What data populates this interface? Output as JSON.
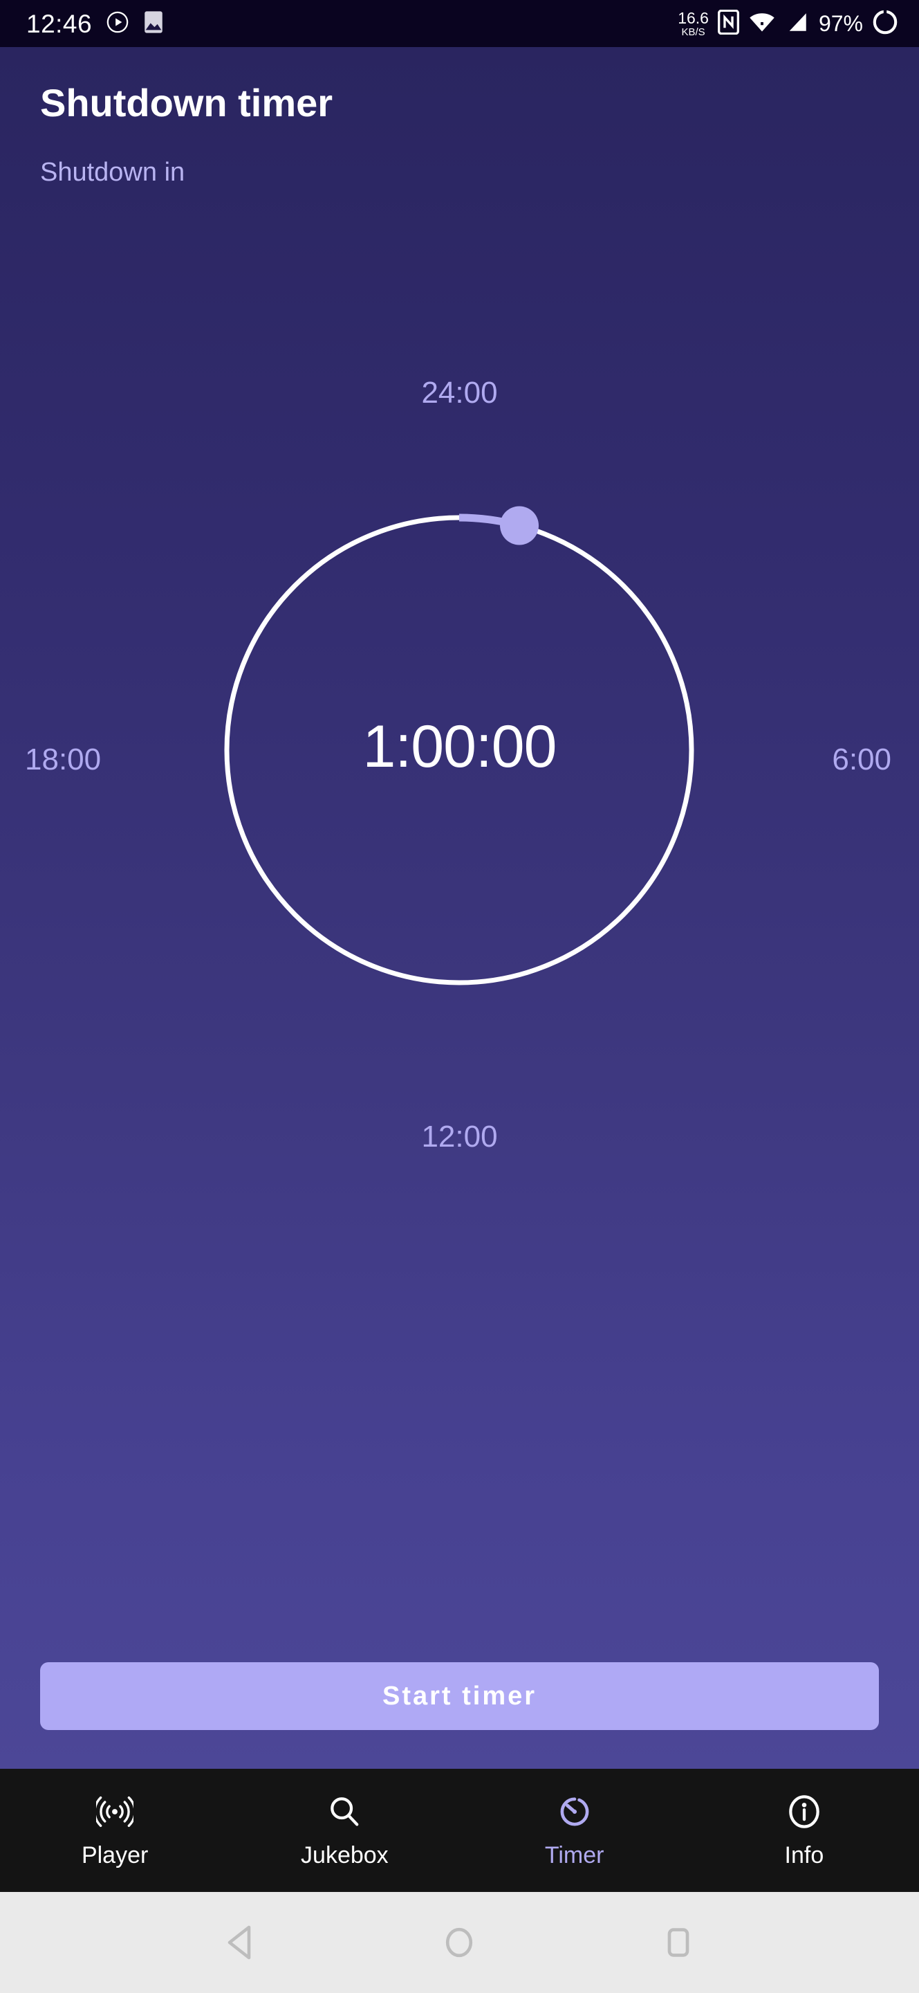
{
  "status_bar": {
    "time": "12:46",
    "icons_left": [
      "play-circle-icon",
      "image-icon"
    ],
    "net_speed_value": "16.6",
    "net_speed_unit": "KB/S",
    "icons_right": [
      "nfc-icon",
      "wifi-icon",
      "signal-icon"
    ],
    "battery_percent": "97%",
    "battery_icon": "battery-circle-icon"
  },
  "header": {
    "title": "Shutdown timer",
    "subtitle": "Shutdown in"
  },
  "dial": {
    "label_top": "24:00",
    "label_right": "6:00",
    "label_bottom": "12:00",
    "label_left": "18:00",
    "center_time": "1:00:00",
    "progress_fraction": 0.0417,
    "ring_color": "#ffffff",
    "progress_color": "#b0aaf0",
    "knob_color": "#b0aaf0"
  },
  "actions": {
    "start_label": "Start timer",
    "start_bg": "#afa9f5"
  },
  "bottom_nav": {
    "active_color": "#b0aaf0",
    "items": [
      {
        "label": "Player",
        "icon": "broadcast-icon",
        "active": false
      },
      {
        "label": "Jukebox",
        "icon": "search-icon",
        "active": false
      },
      {
        "label": "Timer",
        "icon": "timer-icon",
        "active": true
      },
      {
        "label": "Info",
        "icon": "info-icon",
        "active": false
      }
    ]
  },
  "android_nav": {
    "back": "back-triangle-icon",
    "home": "home-circle-icon",
    "recents": "recents-square-icon"
  },
  "theme": {
    "bg_top": "#2a2560",
    "bg_bottom": "#4c4797",
    "status_bg": "#0a0420",
    "nav_bg": "#141414",
    "android_nav_bg": "#eaeaea"
  }
}
